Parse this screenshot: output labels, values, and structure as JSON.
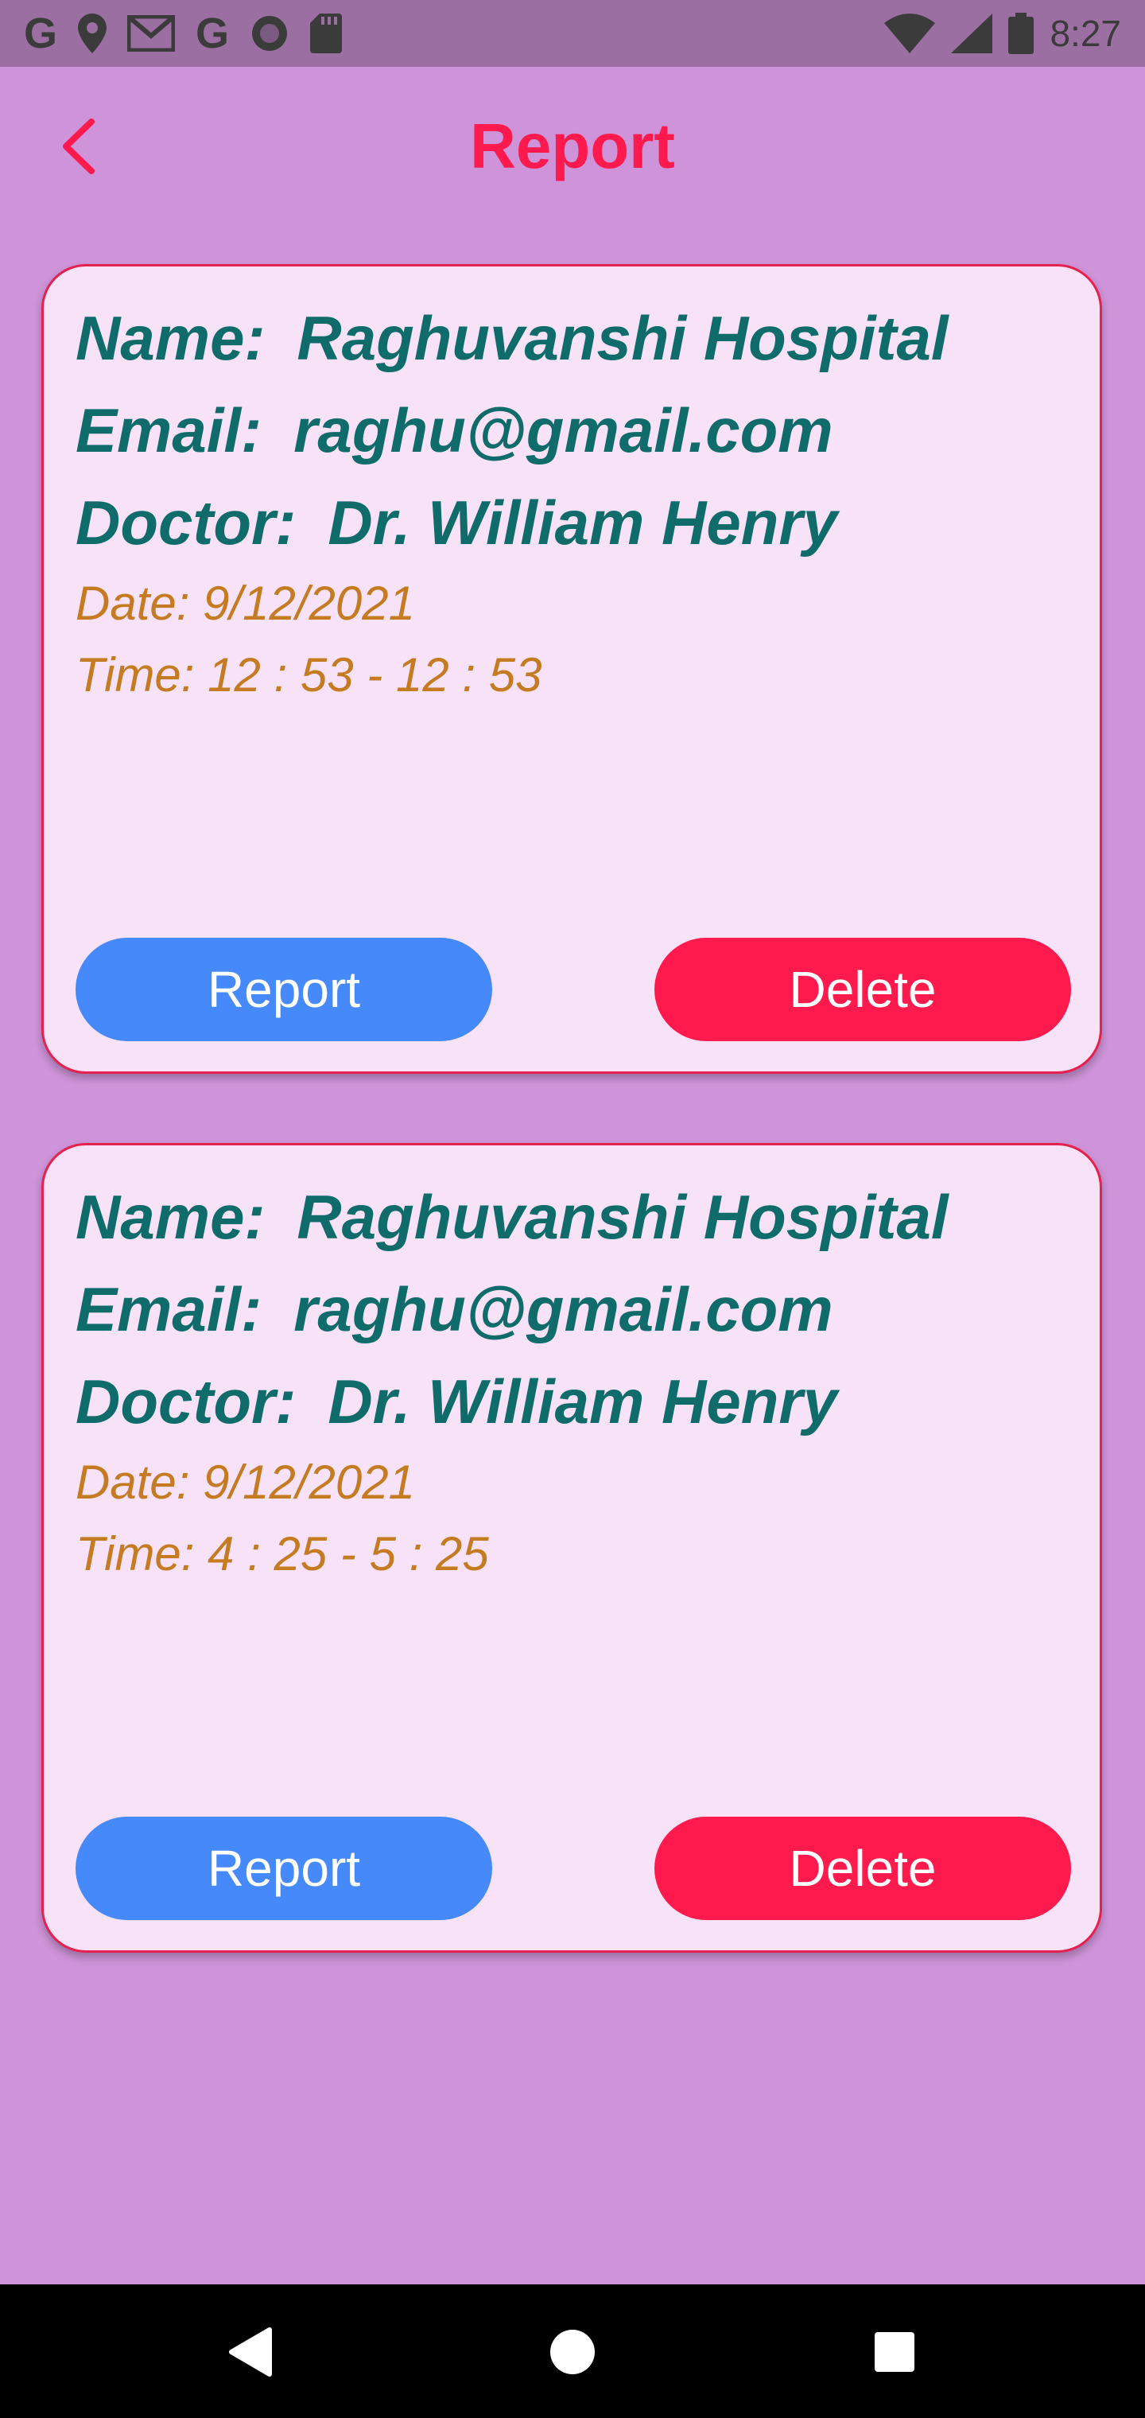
{
  "status_bar": {
    "time": "8:27",
    "left_icons": [
      "google-icon",
      "location-icon",
      "gmail-icon",
      "google-icon",
      "circle-icon",
      "sd-card-icon"
    ],
    "right_icons": [
      "wifi-icon",
      "signal-icon",
      "battery-icon"
    ]
  },
  "app_bar": {
    "title": "Report",
    "back_icon": "chevron-left-icon"
  },
  "cards": [
    {
      "name_label": "Name:",
      "name_value": "Raghuvanshi Hospital",
      "email_label": "Email:",
      "email_value": "raghu@gmail.com",
      "doctor_label": "Doctor:",
      "doctor_value": "Dr. William Henry",
      "date": "Date: 9/12/2021",
      "time": "Time: 12 : 53 - 12 : 53",
      "report_label": "Report",
      "delete_label": "Delete"
    },
    {
      "name_label": "Name:",
      "name_value": "Raghuvanshi Hospital",
      "email_label": "Email:",
      "email_value": "raghu@gmail.com",
      "doctor_label": "Doctor:",
      "doctor_value": "Dr. William Henry",
      "date": "Date: 9/12/2021",
      "time": "Time: 4 : 25 - 5 : 25",
      "report_label": "Report",
      "delete_label": "Delete"
    }
  ],
  "colors": {
    "background": "#ce93d8",
    "accent": "#ff1a4d",
    "report_button": "#4689fb",
    "heading_text": "#106b6b",
    "sub_text": "#c47b22"
  },
  "nav_bar": {
    "icons": [
      "back-triangle-icon",
      "home-circle-icon",
      "recents-square-icon"
    ]
  }
}
